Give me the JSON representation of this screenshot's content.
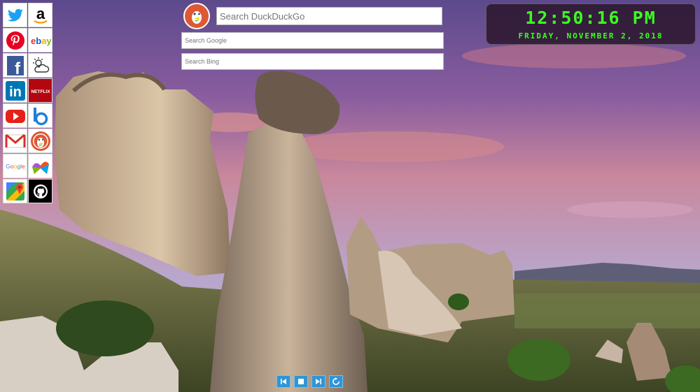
{
  "tiles": [
    {
      "name": "twitter-icon",
      "color": "#1da1f2"
    },
    {
      "name": "amazon-icon",
      "color": "#000000"
    },
    {
      "name": "pinterest-icon",
      "color": "#e60023"
    },
    {
      "name": "ebay-icon",
      "color": "#e53238"
    },
    {
      "name": "facebook-icon",
      "color": "#3b5998"
    },
    {
      "name": "weather-icon",
      "color": "#333333"
    },
    {
      "name": "linkedin-icon",
      "color": "#0077b5"
    },
    {
      "name": "netflix-icon",
      "color": "#b20710"
    },
    {
      "name": "youtube-icon",
      "color": "#e62117"
    },
    {
      "name": "bing-icon",
      "color": "#1f7fd8"
    },
    {
      "name": "gmail-icon",
      "color": "#d93025"
    },
    {
      "name": "duckduckgo-icon",
      "color": "#de5833"
    },
    {
      "name": "google-icon",
      "color": "#4285f4"
    },
    {
      "name": "microsoft-store-icon",
      "color": "#f25022"
    },
    {
      "name": "google-maps-icon",
      "color": "#34a853"
    },
    {
      "name": "github-icon",
      "color": "#000000"
    }
  ],
  "tile_text": {
    "amazon": "a",
    "ebay": [
      "e",
      "b",
      "a",
      "y"
    ],
    "netflix": "NETFLIX",
    "google": [
      "G",
      "o",
      "o",
      "g",
      "l",
      "e"
    ],
    "linkedin": "in",
    "facebook": "f"
  },
  "search": {
    "duckduckgo_placeholder": "Search DuckDuckGo",
    "google_placeholder": "Search Google",
    "bing_placeholder": "Search Bing"
  },
  "clock": {
    "time": "12:50:16 PM",
    "date": "Friday, November 2, 2018",
    "color": "#3cff1e"
  },
  "media_controls": [
    {
      "name": "previous-icon",
      "color": "#2f95d6"
    },
    {
      "name": "stop-icon",
      "color": "#2f95d6"
    },
    {
      "name": "next-icon",
      "color": "#2f95d6"
    },
    {
      "name": "refresh-icon",
      "color": "#2f95d6"
    }
  ]
}
